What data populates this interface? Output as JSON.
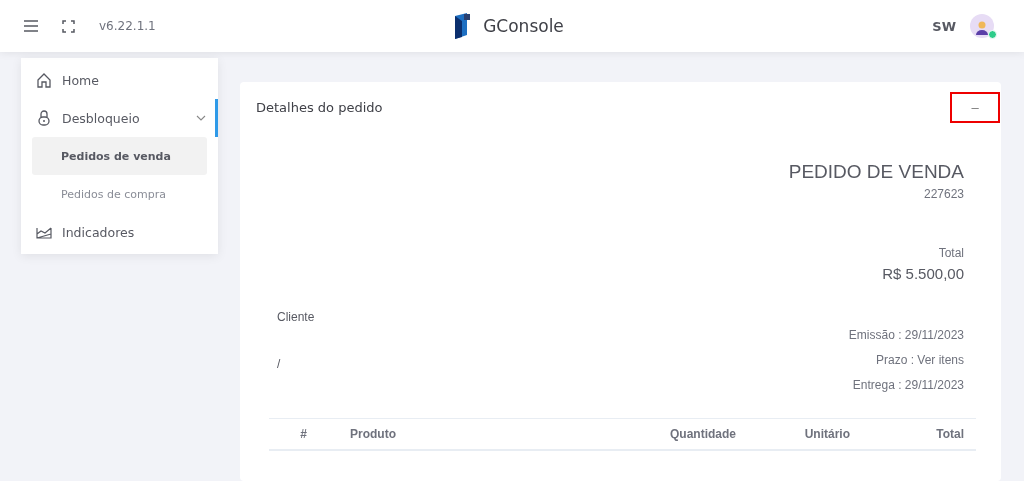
{
  "header": {
    "version": "v6.22.1.1",
    "app_name": "GConsole",
    "user_initials": "SW",
    "user_online": true
  },
  "sidebar": {
    "items": [
      {
        "kind": "link",
        "label": "Home",
        "selected": false
      },
      {
        "kind": "group",
        "label": "Desbloqueio",
        "expanded": true,
        "selected": true,
        "children": [
          {
            "label": "Pedidos de venda",
            "selected": true
          },
          {
            "label": "Pedidos de compra",
            "selected": false
          }
        ]
      },
      {
        "kind": "link",
        "label": "Indicadores",
        "selected": false
      }
    ]
  },
  "order_card": {
    "title": "Detalhes do pedido",
    "collapse_button": {
      "label": "–",
      "highlighted": true
    },
    "document_title": "PEDIDO DE VENDA",
    "order_number": "227623",
    "total_label": "Total",
    "total_value": "R$ 5.500,00",
    "client_label": "Cliente",
    "client_value": "/",
    "dates": [
      "Emissão : 29/11/2023",
      "Prazo : Ver itens",
      "Entrega : 29/11/2023"
    ],
    "table": {
      "columns": [
        "#",
        "Produto",
        "Quantidade",
        "Unitário",
        "Total"
      ]
    }
  }
}
